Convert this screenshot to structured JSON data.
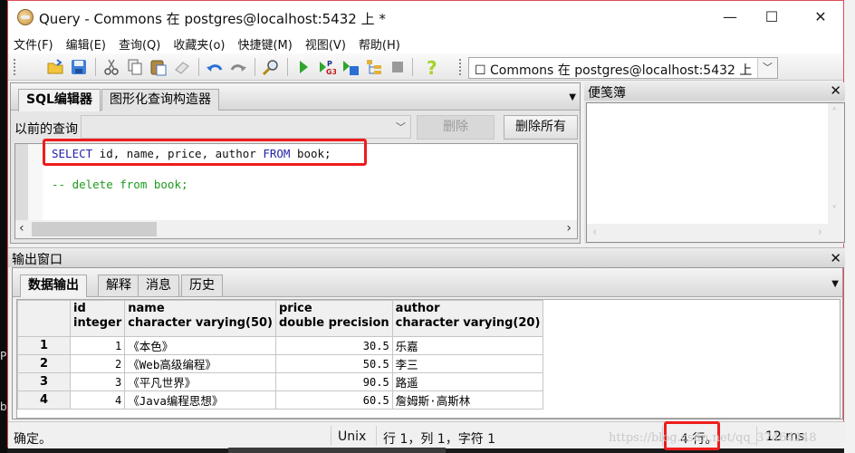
{
  "window": {
    "title": "Query - Commons 在  postgres@localhost:5432 上 *",
    "minimize": "—",
    "maximize": "☐",
    "close": "✕"
  },
  "menu": [
    {
      "label": "文件(F)"
    },
    {
      "label": "编辑(E)"
    },
    {
      "label": "查询(Q)"
    },
    {
      "label": "收藏夹(o)"
    },
    {
      "label": "快捷键(M)"
    },
    {
      "label": "视图(V)"
    },
    {
      "label": "帮助(H)"
    }
  ],
  "toolbar": {
    "icons": [
      "open-file-icon",
      "save-icon",
      "cut-icon",
      "copy-icon",
      "paste-icon",
      "clear-icon",
      "undo-icon",
      "redo-icon",
      "find-icon",
      "execute-icon",
      "execute-pgscript-icon",
      "execute-to-file-icon",
      "explain-icon",
      "cancel-icon",
      "help-icon"
    ],
    "db_selector": "☐ Commons 在  postgres@localhost:5432 上"
  },
  "query_panel": {
    "tabs": [
      "SQL编辑器",
      "图形化查询构造器"
    ],
    "active_tab": 0,
    "prev_label": "以前的查询",
    "prev_value": "",
    "delete_label": "删除",
    "delete_all_label": "删除所有",
    "code": {
      "line1": {
        "kw1": "SELECT",
        "cols": " id, name, price, author ",
        "kw2": "FROM",
        "tbl": " book;"
      },
      "line2": "-- delete from book;"
    }
  },
  "scratch_pad": {
    "title": "便笺簿",
    "content": ""
  },
  "output": {
    "title": "输出窗口",
    "tabs": [
      "数据输出",
      "解释",
      "消息",
      "历史"
    ],
    "active_tab": 0,
    "columns": [
      {
        "name": "id",
        "type": "integer"
      },
      {
        "name": "name",
        "type": "character varying(50)"
      },
      {
        "name": "price",
        "type": "double precision"
      },
      {
        "name": "author",
        "type": "character varying(20)"
      }
    ],
    "rows": [
      {
        "n": "1",
        "id": "1",
        "name": "《本色》",
        "price": "30.5",
        "author": "乐嘉"
      },
      {
        "n": "2",
        "id": "2",
        "name": "《Web高级编程》",
        "price": "50.5",
        "author": "李三"
      },
      {
        "n": "3",
        "id": "3",
        "name": "《平凡世界》",
        "price": "90.5",
        "author": "路遥"
      },
      {
        "n": "4",
        "id": "4",
        "name": "《Java编程思想》",
        "price": "60.5",
        "author": "詹姆斯·高斯林"
      }
    ]
  },
  "status": {
    "message": "确定。",
    "line_ending": "Unix",
    "position": "行 1，列 1，字符 1",
    "row_count": "4 行。",
    "duration": "12 ms"
  },
  "watermark": "https://blog.csdn.net/qq_37464248",
  "desktop": {
    "frag1": "P",
    "frag2": "b"
  },
  "highlight_color": "#ee1c1c"
}
